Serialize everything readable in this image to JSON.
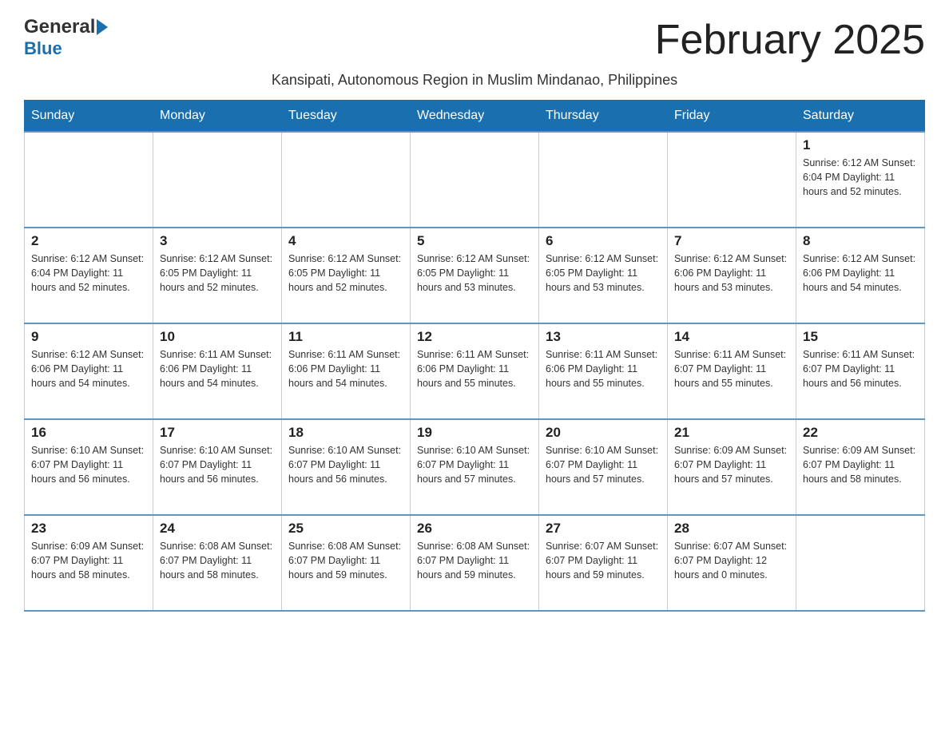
{
  "header": {
    "logo_general": "General",
    "logo_blue": "Blue",
    "month_title": "February 2025",
    "subtitle": "Kansipati, Autonomous Region in Muslim Mindanao, Philippines"
  },
  "days_of_week": [
    "Sunday",
    "Monday",
    "Tuesday",
    "Wednesday",
    "Thursday",
    "Friday",
    "Saturday"
  ],
  "weeks": [
    [
      {
        "day": "",
        "info": ""
      },
      {
        "day": "",
        "info": ""
      },
      {
        "day": "",
        "info": ""
      },
      {
        "day": "",
        "info": ""
      },
      {
        "day": "",
        "info": ""
      },
      {
        "day": "",
        "info": ""
      },
      {
        "day": "1",
        "info": "Sunrise: 6:12 AM\nSunset: 6:04 PM\nDaylight: 11 hours and 52 minutes."
      }
    ],
    [
      {
        "day": "2",
        "info": "Sunrise: 6:12 AM\nSunset: 6:04 PM\nDaylight: 11 hours and 52 minutes."
      },
      {
        "day": "3",
        "info": "Sunrise: 6:12 AM\nSunset: 6:05 PM\nDaylight: 11 hours and 52 minutes."
      },
      {
        "day": "4",
        "info": "Sunrise: 6:12 AM\nSunset: 6:05 PM\nDaylight: 11 hours and 52 minutes."
      },
      {
        "day": "5",
        "info": "Sunrise: 6:12 AM\nSunset: 6:05 PM\nDaylight: 11 hours and 53 minutes."
      },
      {
        "day": "6",
        "info": "Sunrise: 6:12 AM\nSunset: 6:05 PM\nDaylight: 11 hours and 53 minutes."
      },
      {
        "day": "7",
        "info": "Sunrise: 6:12 AM\nSunset: 6:06 PM\nDaylight: 11 hours and 53 minutes."
      },
      {
        "day": "8",
        "info": "Sunrise: 6:12 AM\nSunset: 6:06 PM\nDaylight: 11 hours and 54 minutes."
      }
    ],
    [
      {
        "day": "9",
        "info": "Sunrise: 6:12 AM\nSunset: 6:06 PM\nDaylight: 11 hours and 54 minutes."
      },
      {
        "day": "10",
        "info": "Sunrise: 6:11 AM\nSunset: 6:06 PM\nDaylight: 11 hours and 54 minutes."
      },
      {
        "day": "11",
        "info": "Sunrise: 6:11 AM\nSunset: 6:06 PM\nDaylight: 11 hours and 54 minutes."
      },
      {
        "day": "12",
        "info": "Sunrise: 6:11 AM\nSunset: 6:06 PM\nDaylight: 11 hours and 55 minutes."
      },
      {
        "day": "13",
        "info": "Sunrise: 6:11 AM\nSunset: 6:06 PM\nDaylight: 11 hours and 55 minutes."
      },
      {
        "day": "14",
        "info": "Sunrise: 6:11 AM\nSunset: 6:07 PM\nDaylight: 11 hours and 55 minutes."
      },
      {
        "day": "15",
        "info": "Sunrise: 6:11 AM\nSunset: 6:07 PM\nDaylight: 11 hours and 56 minutes."
      }
    ],
    [
      {
        "day": "16",
        "info": "Sunrise: 6:10 AM\nSunset: 6:07 PM\nDaylight: 11 hours and 56 minutes."
      },
      {
        "day": "17",
        "info": "Sunrise: 6:10 AM\nSunset: 6:07 PM\nDaylight: 11 hours and 56 minutes."
      },
      {
        "day": "18",
        "info": "Sunrise: 6:10 AM\nSunset: 6:07 PM\nDaylight: 11 hours and 56 minutes."
      },
      {
        "day": "19",
        "info": "Sunrise: 6:10 AM\nSunset: 6:07 PM\nDaylight: 11 hours and 57 minutes."
      },
      {
        "day": "20",
        "info": "Sunrise: 6:10 AM\nSunset: 6:07 PM\nDaylight: 11 hours and 57 minutes."
      },
      {
        "day": "21",
        "info": "Sunrise: 6:09 AM\nSunset: 6:07 PM\nDaylight: 11 hours and 57 minutes."
      },
      {
        "day": "22",
        "info": "Sunrise: 6:09 AM\nSunset: 6:07 PM\nDaylight: 11 hours and 58 minutes."
      }
    ],
    [
      {
        "day": "23",
        "info": "Sunrise: 6:09 AM\nSunset: 6:07 PM\nDaylight: 11 hours and 58 minutes."
      },
      {
        "day": "24",
        "info": "Sunrise: 6:08 AM\nSunset: 6:07 PM\nDaylight: 11 hours and 58 minutes."
      },
      {
        "day": "25",
        "info": "Sunrise: 6:08 AM\nSunset: 6:07 PM\nDaylight: 11 hours and 59 minutes."
      },
      {
        "day": "26",
        "info": "Sunrise: 6:08 AM\nSunset: 6:07 PM\nDaylight: 11 hours and 59 minutes."
      },
      {
        "day": "27",
        "info": "Sunrise: 6:07 AM\nSunset: 6:07 PM\nDaylight: 11 hours and 59 minutes."
      },
      {
        "day": "28",
        "info": "Sunrise: 6:07 AM\nSunset: 6:07 PM\nDaylight: 12 hours and 0 minutes."
      },
      {
        "day": "",
        "info": ""
      }
    ]
  ]
}
